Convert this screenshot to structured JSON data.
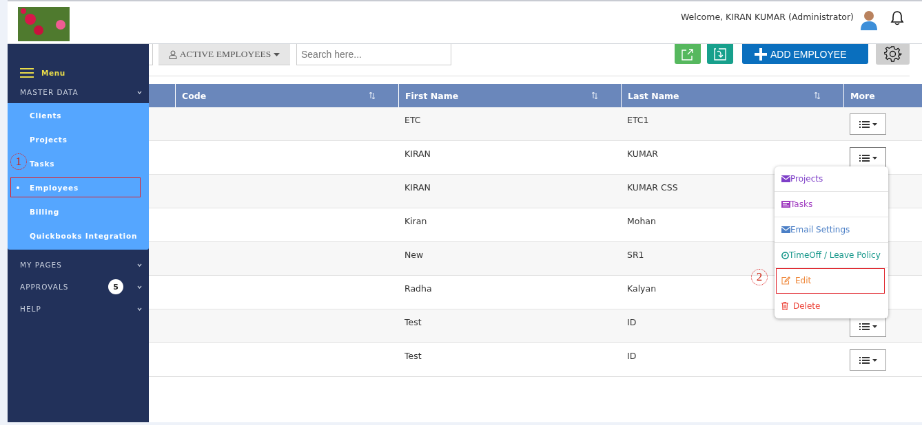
{
  "header": {
    "welcome": "Welcome, KIRAN KUMAR (Administrator)"
  },
  "sidebar": {
    "menu_label": "Menu",
    "sections": [
      {
        "label": "MASTER DATA",
        "items": [
          {
            "label": "Clients",
            "selected": false
          },
          {
            "label": "Projects",
            "selected": false
          },
          {
            "label": "Tasks",
            "selected": false
          },
          {
            "label": "Employees",
            "selected": true,
            "callout": "1"
          },
          {
            "label": "Billing",
            "selected": false
          },
          {
            "label": "Quickbooks Integration",
            "selected": false
          }
        ]
      },
      {
        "label": "MY PAGES"
      },
      {
        "label": "APPROVALS",
        "badge": "5"
      },
      {
        "label": "HELP"
      }
    ]
  },
  "toolbar": {
    "filter": "ACTIVE EMPLOYEES",
    "search": {
      "placeholder": "Search here..."
    },
    "add_button": "ADD EMPLOYEE"
  },
  "table": {
    "columns": [
      {
        "label": "Code",
        "sortable": true
      },
      {
        "label": "First Name",
        "sortable": true
      },
      {
        "label": "Last Name",
        "sortable": true
      },
      {
        "label": "More",
        "sortable": false
      }
    ],
    "rows": [
      {
        "first_name": "ETC",
        "last_name": "ETC1",
        "menu_open": false
      },
      {
        "first_name": "KIRAN",
        "last_name": "KUMAR",
        "menu_open": true
      },
      {
        "first_name": "KIRAN",
        "last_name": "KUMAR CSS",
        "menu_open": false
      },
      {
        "first_name": "Kiran",
        "last_name": "Mohan",
        "menu_open": false
      },
      {
        "first_name": "New",
        "last_name": "SR1",
        "menu_open": false
      },
      {
        "first_name": "Radha",
        "last_name": "Kalyan",
        "menu_open": false
      },
      {
        "first_name": "Test",
        "last_name": "ID",
        "menu_open": false
      },
      {
        "first_name": "Test",
        "last_name": "ID",
        "menu_open": false
      }
    ]
  },
  "more_menu": {
    "items": [
      {
        "label": "Projects",
        "kind": "envelope",
        "color": "#7e3fc8"
      },
      {
        "label": "Tasks",
        "kind": "list",
        "color": "#a03cc0"
      },
      {
        "label": "Email Settings",
        "kind": "envelope",
        "color": "#4b7fc6"
      },
      {
        "label": "TimeOff / Leave Policy",
        "kind": "clock",
        "color": "#15978a"
      },
      {
        "label": "Edit",
        "kind": "edit",
        "color": "#ef8a3e",
        "callout": "2"
      },
      {
        "label": "Delete",
        "kind": "trash",
        "color": "#ec4136"
      }
    ]
  }
}
